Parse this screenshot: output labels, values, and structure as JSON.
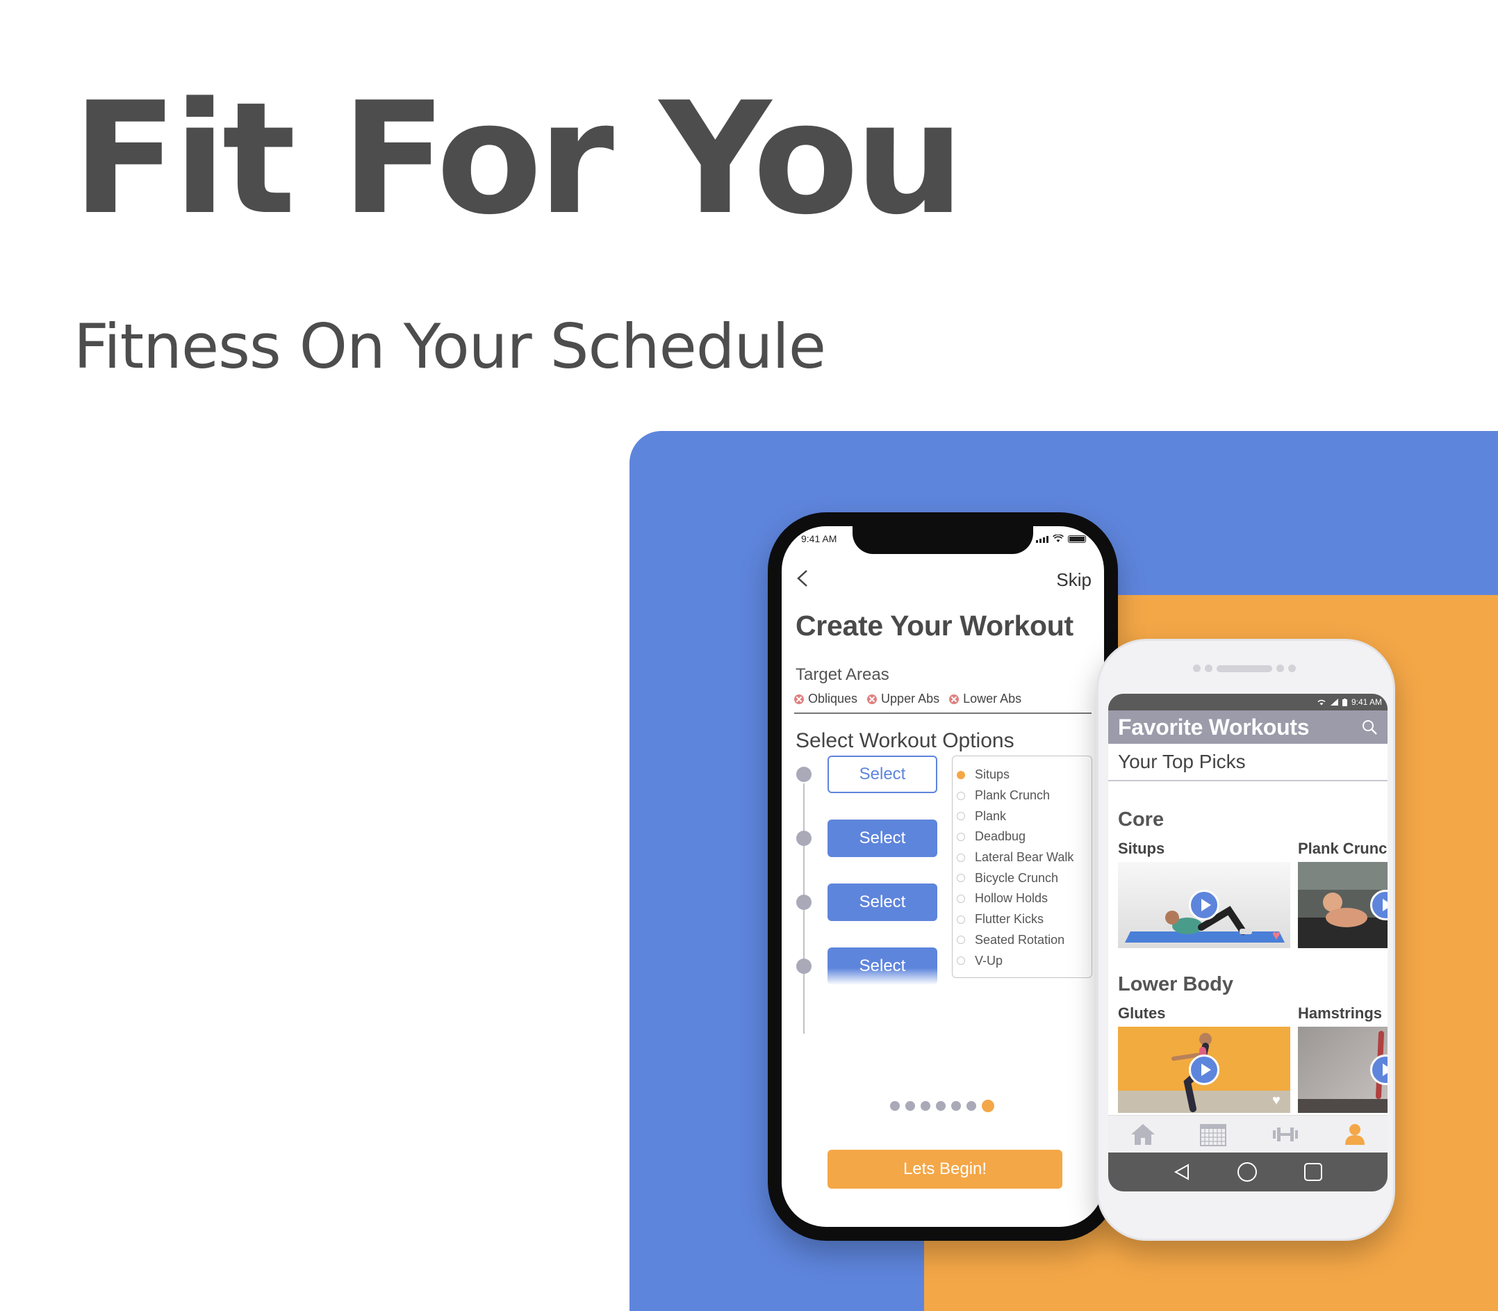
{
  "hero": {
    "title": "Fit For You",
    "subtitle": "Fitness On Your Schedule"
  },
  "colors": {
    "accent_blue": "#5e85dc",
    "accent_orange": "#f4a747",
    "header_gray": "#9b9baa",
    "text_dark": "#4d4d4d"
  },
  "phone1": {
    "status_time": "9:41 AM",
    "back_icon": "chevron-left-icon",
    "skip_label": "Skip",
    "title": "Create Your Workout",
    "target_areas_label": "Target Areas",
    "target_areas": [
      "Obliques",
      "Upper Abs",
      "Lower Abs"
    ],
    "options_label": "Select Workout Options",
    "select_buttons": [
      "Select",
      "Select",
      "Select",
      "Select"
    ],
    "exercise_options": [
      {
        "label": "Situps",
        "selected": true
      },
      {
        "label": "Plank Crunch",
        "selected": false
      },
      {
        "label": "Plank",
        "selected": false
      },
      {
        "label": "Deadbug",
        "selected": false
      },
      {
        "label": "Lateral Bear Walk",
        "selected": false
      },
      {
        "label": "Bicycle Crunch",
        "selected": false
      },
      {
        "label": "Hollow Holds",
        "selected": false
      },
      {
        "label": "Flutter Kicks",
        "selected": false
      },
      {
        "label": "Seated Rotation",
        "selected": false
      },
      {
        "label": "V-Up",
        "selected": false
      }
    ],
    "page_dots": {
      "count": 7,
      "active": 7
    },
    "begin_label": "Lets Begin!"
  },
  "phone2": {
    "status_time": "9:41 AM",
    "header_title": "Favorite Workouts",
    "search_icon": "search-icon",
    "subtitle": "Your Top Picks",
    "sections": [
      {
        "title": "Core",
        "cards": [
          "Situps",
          "Plank Crunc"
        ]
      },
      {
        "title": "Lower Body",
        "cards": [
          "Glutes",
          "Hamstrings"
        ]
      }
    ],
    "tabs": [
      "home-icon",
      "calendar-icon",
      "dumbbell-icon",
      "profile-icon"
    ],
    "active_tab": "profile-icon",
    "nav_buttons": [
      "back-icon",
      "home-circle-icon",
      "recents-icon"
    ]
  }
}
